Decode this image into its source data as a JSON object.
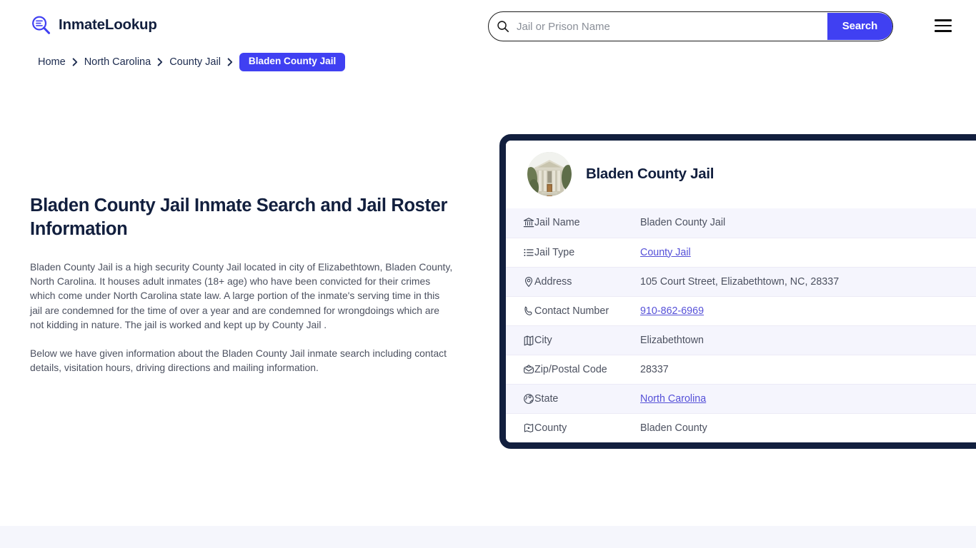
{
  "header": {
    "brand_name": "InmateLookup",
    "brand_icon": "search-list-logo-icon",
    "search": {
      "placeholder": "Jail or Prison Name",
      "value": "",
      "icon": "search-icon",
      "button_label": "Search"
    },
    "menu_icon": "hamburger-menu-icon"
  },
  "breadcrumb": {
    "items": [
      {
        "label": "Home",
        "current": false
      },
      {
        "label": "North Carolina",
        "current": false
      },
      {
        "label": "County Jail",
        "current": false
      },
      {
        "label": "Bladen County Jail",
        "current": true
      }
    ],
    "separator_icon": "chevron-right-icon"
  },
  "main": {
    "title": "Bladen County Jail Inmate Search and Jail Roster Information",
    "paragraphs": [
      "Bladen County Jail is a high security County Jail located in city of Elizabethtown, Bladen County, North Carolina. It houses adult inmates (18+ age) who have been convicted for their crimes which come under North Carolina state law. A large portion of the inmate's serving time in this jail are condemned for the time of over a year and are condemned for wrongdoings which are not kidding in nature. The jail is worked and kept up by County Jail .",
      "Below we have given information about the Bladen County Jail inmate search including contact details, visitation hours, driving directions and mailing information."
    ]
  },
  "info_card": {
    "title": "Bladen County Jail",
    "avatar_icon": "courthouse-building-photo",
    "rows": [
      {
        "icon": "bank-icon",
        "label": "Jail Name",
        "value": "Bladen County Jail",
        "is_link": false
      },
      {
        "icon": "list-icon",
        "label": "Jail Type",
        "value": "County Jail",
        "is_link": true
      },
      {
        "icon": "map-pin-icon",
        "label": "Address",
        "value": "105 Court Street, Elizabethtown, NC, 28337",
        "is_link": false
      },
      {
        "icon": "phone-icon",
        "label": "Contact Number",
        "value": "910-862-6969",
        "is_link": true
      },
      {
        "icon": "map-icon",
        "label": "City",
        "value": "Elizabethtown",
        "is_link": false
      },
      {
        "icon": "envelope-icon",
        "label": "Zip/Postal Code",
        "value": "28337",
        "is_link": false
      },
      {
        "icon": "globe-icon",
        "label": "State",
        "value": "North Carolina",
        "is_link": true
      },
      {
        "icon": "region-icon",
        "label": "County",
        "value": "Bladen County",
        "is_link": false
      }
    ]
  },
  "colors": {
    "brand_blue": "#4040f2",
    "link_blue": "#5550d8",
    "navy": "#121f3e",
    "row_tint": "#f5f5fd",
    "body_text": "#4c5160",
    "footer_strip": "#f5f6fc"
  }
}
